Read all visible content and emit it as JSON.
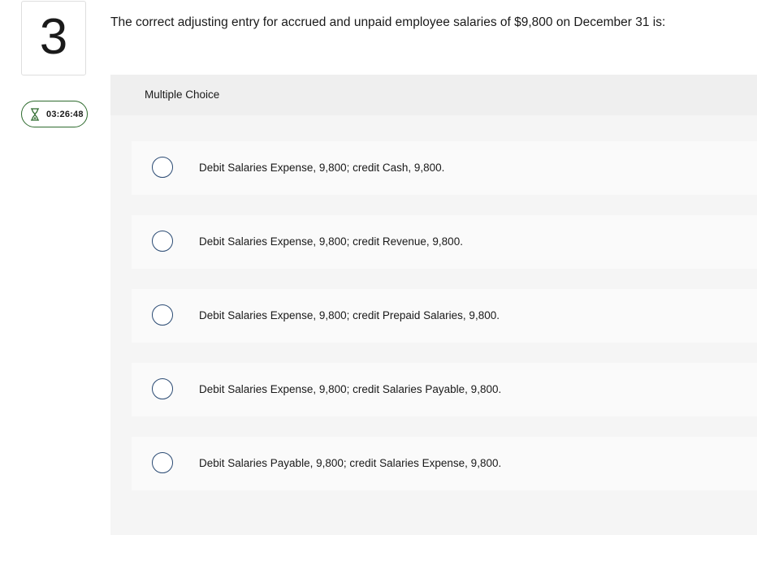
{
  "question": {
    "number": "3",
    "timer": "03:26:48",
    "text": "The correct adjusting entry for accrued and unpaid employee salaries of $9,800 on December 31 is:"
  },
  "multiple_choice": {
    "label": "Multiple Choice",
    "options": [
      {
        "label": "Debit Salaries Expense, 9,800; credit Cash, 9,800.",
        "selected": false
      },
      {
        "label": "Debit Salaries Expense, 9,800; credit Revenue, 9,800.",
        "selected": false
      },
      {
        "label": "Debit Salaries Expense, 9,800; credit Prepaid Salaries, 9,800.",
        "selected": false
      },
      {
        "label": "Debit Salaries Expense, 9,800; credit Salaries Payable, 9,800.",
        "selected": false
      },
      {
        "label": "Debit Salaries Payable, 9,800; credit Salaries Expense, 9,800.",
        "selected": false
      }
    ]
  },
  "colors": {
    "timer_border": "#2e6b2e",
    "radio_border": "#2a4a73",
    "panel_bg": "#f5f5f5"
  },
  "icons": {
    "timer": "hourglass-icon"
  }
}
